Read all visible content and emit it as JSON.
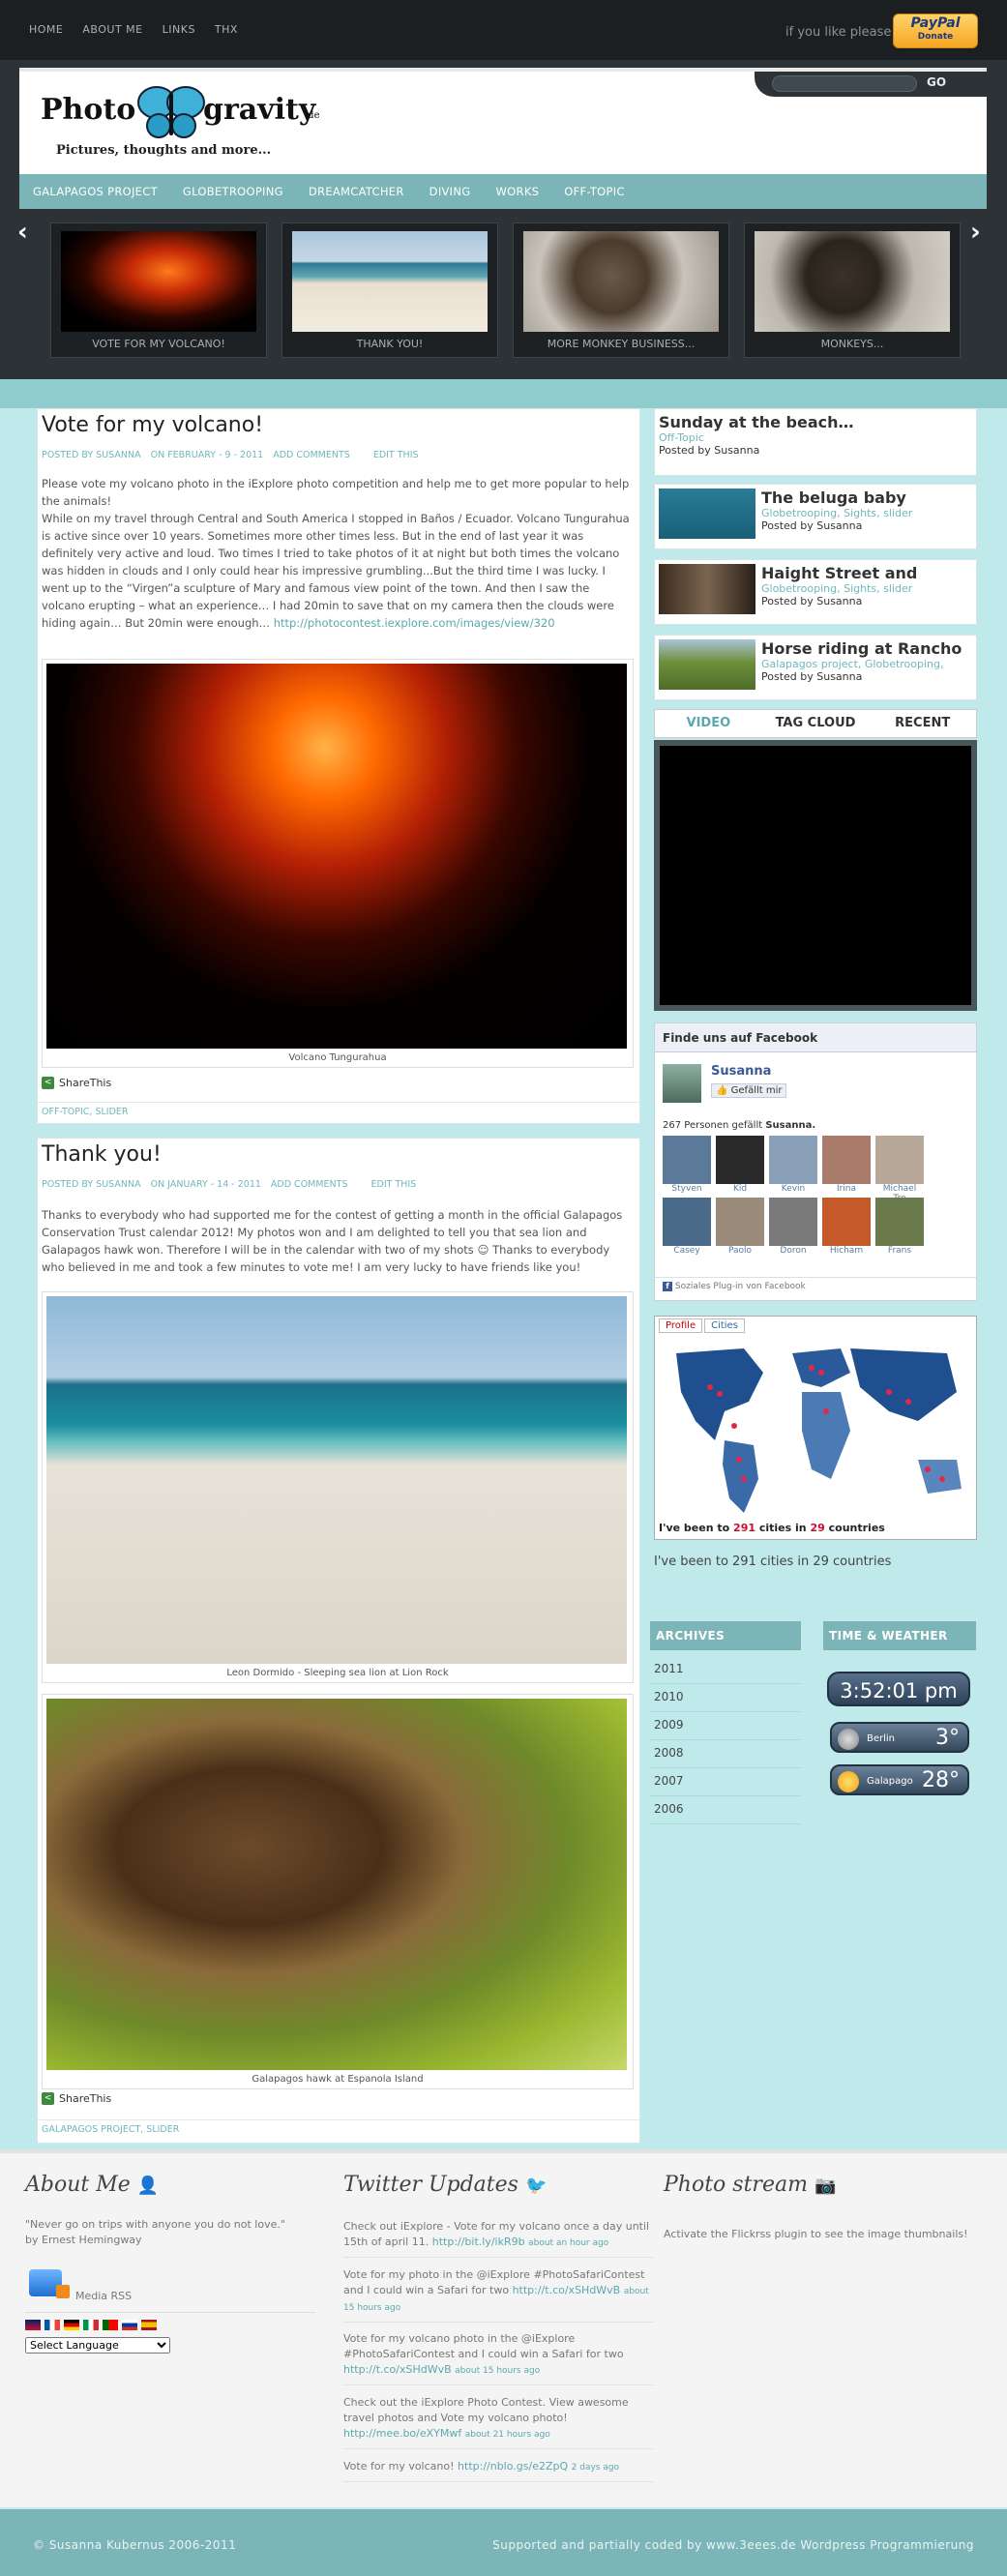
{
  "topnav": [
    "HOME",
    "ABOUT ME",
    "LINKS",
    "THX"
  ],
  "paypal": {
    "prompt": "if you like please",
    "brand": "PayPal",
    "action": "Donate"
  },
  "logo": {
    "word1": "Photo",
    "word2": "gravity",
    "tld": ".de",
    "tagline": "Pictures, thoughts and more..."
  },
  "search": {
    "go": "GO",
    "placeholder": ""
  },
  "catnav": [
    "GALAPAGOS PROJECT",
    "GLOBETROOPING",
    "DREAMCATCHER",
    "DIVING",
    "WORKS",
    "OFF-TOPIC"
  ],
  "slider": [
    {
      "caption": "VOTE FOR MY VOLCANO!"
    },
    {
      "caption": "THANK YOU!"
    },
    {
      "caption": "MORE MONKEY BUSINESS..."
    },
    {
      "caption": "MONKEYS..."
    }
  ],
  "posts": [
    {
      "title": "Vote for my volcano!",
      "author": "POSTED BY SUSANNA",
      "date": "ON FEBRUARY - 9 - 2011",
      "comments": "ADD COMMENTS",
      "edit": "EDIT THIS",
      "p1": "Please vote my volcano photo in the iExplore photo competition and help me to get more popular to help the animals!",
      "p2": "While on my travel through Central and South America I stopped in Baños / Ecuador. Volcano Tungurahua is active since over 10 years. Sometimes more other times less. But in the end of last year it was definitely very active and loud. Two times I tried to take photos of it at night but both times the volcano was hidden in clouds and I only could hear his impressive grumbling...But the third time I was lucky. I went up to the “Virgen”a sculpture of Mary and famous view point of the town. And then I saw the volcano erupting – what an experience… I had 20min to save that on my camera then the clouds were hiding again… But 20min were enough…",
      "link": "http://photocontest.iexplore.com/images/view/320",
      "caption": "Volcano Tungurahua",
      "share": "ShareThis",
      "cats": "OFF-TOPIC, SLIDER"
    },
    {
      "title": "Thank you!",
      "author": "POSTED BY SUSANNA",
      "date": "ON JANUARY - 14 - 2011",
      "comments": "ADD COMMENTS",
      "edit": "EDIT THIS",
      "p1a": "Thanks to everybody who had supported me for the contest of getting a month in the official Galapagos Conservation Trust calendar 2012! My photos won and I am delighted to tell you that sea lion and Galapagos hawk won. Therefore I will be in the calendar with two of my shots",
      "p1b": "Thanks to everybody who believed in me and took a few minutes to vote me! I am very lucky to have friends like you!",
      "caption1": "Leon Dormido - Sleeping sea lion at Lion Rock",
      "caption2": "Galapagos hawk at Espanola Island",
      "share": "ShareThis",
      "cats": "GALAPAGOS PROJECT, SLIDER"
    }
  ],
  "sidebar_posts": [
    {
      "title": "Sunday at the beach…",
      "cats": "Off-Topic",
      "by": "Posted by Susanna"
    },
    {
      "title": "The beluga baby",
      "cats": "Globetrooping, Sights, slider",
      "by": "Posted by Susanna"
    },
    {
      "title": "Haight Street and",
      "cats": "Globetrooping, Sights, slider",
      "by": "Posted by Susanna"
    },
    {
      "title": "Horse riding at Rancho",
      "cats": "Galapagos project, Globetrooping,",
      "by": "Posted by Susanna"
    }
  ],
  "tabs": [
    "VIDEO",
    "TAG CLOUD",
    "RECENT"
  ],
  "facebook": {
    "header": "Finde uns auf Facebook",
    "name": "Susanna",
    "like": "Gefällt mir",
    "count_pre": "267 Personen gefällt",
    "count_name": "Susanna.",
    "people": [
      "Styven",
      "Kid",
      "Kevin",
      "Irina",
      "Michael Tro",
      "Casey",
      "Paolo",
      "Doron",
      "Hicham",
      "Frans"
    ],
    "plugin": "Soziales Plug-in von Facebook"
  },
  "map": {
    "tab1": "Profile",
    "tab2": "Cities",
    "pre": "I've been to",
    "cities": "291",
    "mid": "cities in",
    "countries": "29",
    "post": "countries",
    "summary": "I've been to 291 cities in 29 countries"
  },
  "archives": {
    "heading": "ARCHIVES",
    "years": [
      "2011",
      "2010",
      "2009",
      "2008",
      "2007",
      "2006"
    ]
  },
  "weather": {
    "heading": "TIME & WEATHER",
    "time": "3:52:01 pm",
    "cities": [
      {
        "name": "Berlin",
        "temp": "3°"
      },
      {
        "name": "Galapago",
        "temp": "28°"
      }
    ]
  },
  "about": {
    "heading": "About Me",
    "quote": "\"Never go on trips with anyone you do not love.\"",
    "attrib": "by  Ernest Hemingway",
    "media": "Media RSS",
    "language": "Select Language"
  },
  "twitter": {
    "heading": "Twitter Updates",
    "tweets": [
      {
        "text": "Check out iExplore - Vote for my volcano once a day until 15th of april 11.",
        "link": "http://bit.ly/ikR9b",
        "ago": "about an hour ago"
      },
      {
        "text": "Vote for my photo in the @iExplore #PhotoSafariContest and I could win a Safari for two",
        "link": "http://t.co/xSHdWvB",
        "ago": "about 15 hours ago"
      },
      {
        "text": "Vote for my volcano photo in the @iExplore #PhotoSafariContest and I could win a Safari for two",
        "link": "http://t.co/xSHdWvB",
        "ago": "about 15 hours ago"
      },
      {
        "text": "Check out the iExplore Photo Contest. View awesome travel photos and Vote my volcano photo!",
        "link": "http://mee.bo/eXYMwf",
        "ago": "about 21 hours ago"
      },
      {
        "text": "Vote for my volcano!",
        "link": "http://nblo.gs/e2ZpQ",
        "ago": "2 days ago"
      }
    ]
  },
  "photostream": {
    "heading": "Photo stream",
    "text": "Activate the Flickrss plugin to see the image thumbnails!"
  },
  "footer": {
    "copyright": "© Susanna Kubernus 2006-2011",
    "credits": "Supported and partially coded by www.3eees.de Wordpress Programmierung"
  }
}
